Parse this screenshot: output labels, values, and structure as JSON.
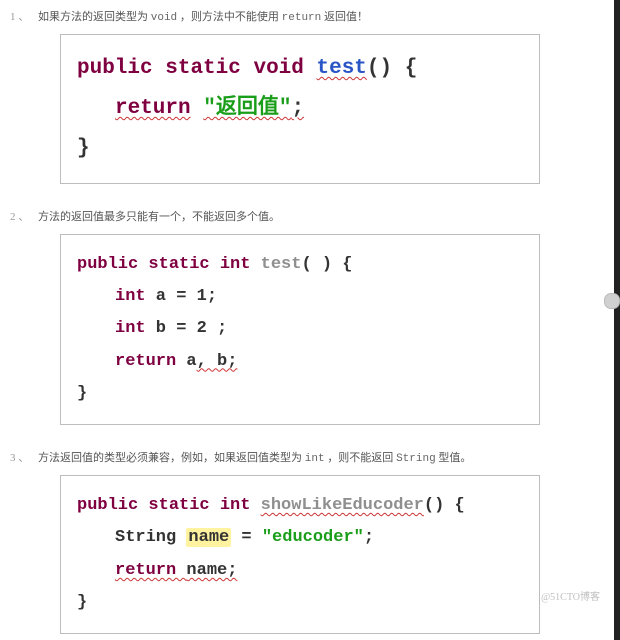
{
  "rules": {
    "r1": {
      "num": "1 、",
      "text_a": "如果方法的返回类型为 ",
      "kw": "void",
      "text_b": " ，则方法中不能使用 ",
      "kw2": "return",
      "text_c": " 返回值！"
    },
    "r2": {
      "num": "2 、",
      "text": "方法的返回值最多只能有一个，不能返回多个值。"
    },
    "r3": {
      "num": "3 、",
      "text_a": "方法返回值的类型必须兼容，例如，如果返回值类型为 ",
      "kw": "int",
      "text_b": " ，则不能返回 ",
      "kw2": "String",
      "text_c": " 型值。"
    }
  },
  "code1": {
    "kw_public": "public",
    "kw_static": "static",
    "kw_void": "void",
    "name": "test",
    "sig_tail": "() {",
    "kw_return": "return",
    "str": "\"返回值\"",
    "semi": ";",
    "close": "}"
  },
  "code2": {
    "kw_public": "public",
    "kw_static": "static",
    "kw_int": "int",
    "name": "test",
    "sig_tail": "( ) {",
    "l1_a": "int",
    "l1_b": " a = 1;",
    "l2_a": "int",
    "l2_b": " b = ",
    "l2_c": "2",
    "l2_d": " ;",
    "l3_a": "return",
    "l3_b": " a",
    "l3_err": ",  b;",
    "close": "}"
  },
  "code3": {
    "kw_public": "public",
    "kw_static": "static",
    "kw_int": "int",
    "name": "showLikeEducoder",
    "sig_tail": "() {",
    "l1_a": "String ",
    "l1_name": "name",
    "l1_b": " = ",
    "l1_str": "\"educoder\"",
    "l1_c": ";",
    "l2_a": "return ",
    "l2_err": " name;",
    "close": "}"
  },
  "watermark": "@51CTO博客"
}
